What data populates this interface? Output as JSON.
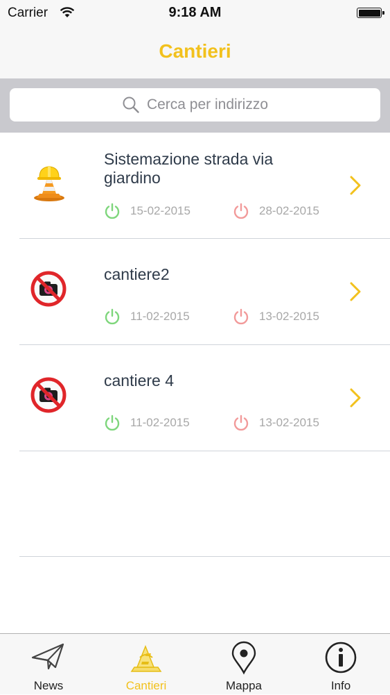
{
  "status": {
    "carrier": "Carrier",
    "time": "9:18 AM"
  },
  "nav": {
    "title": "Cantieri"
  },
  "search": {
    "placeholder": "Cerca per indirizzo"
  },
  "sites": [
    {
      "title": "Sistemazione strada via giardino",
      "start_date": "15-02-2015",
      "end_date": "28-02-2015",
      "thumb_icon": "construction-worker-cone-icon"
    },
    {
      "title": "cantiere2",
      "start_date": "11-02-2015",
      "end_date": "13-02-2015",
      "thumb_icon": "no-photo-icon"
    },
    {
      "title": "cantiere 4",
      "start_date": "11-02-2015",
      "end_date": "13-02-2015",
      "thumb_icon": "no-photo-icon"
    }
  ],
  "tabs": [
    {
      "label": "News",
      "icon": "paper-plane-icon"
    },
    {
      "label": "Cantieri",
      "icon": "construction-icon",
      "selected": true
    },
    {
      "label": "Mappa",
      "icon": "map-pin-icon"
    },
    {
      "label": "Info",
      "icon": "info-icon"
    }
  ],
  "colors": {
    "accent": "#f2c11d",
    "start_green": "#7ed67c",
    "end_red": "#f29a9a",
    "text": "#2f3b4a",
    "muted": "#a8a8a8"
  }
}
